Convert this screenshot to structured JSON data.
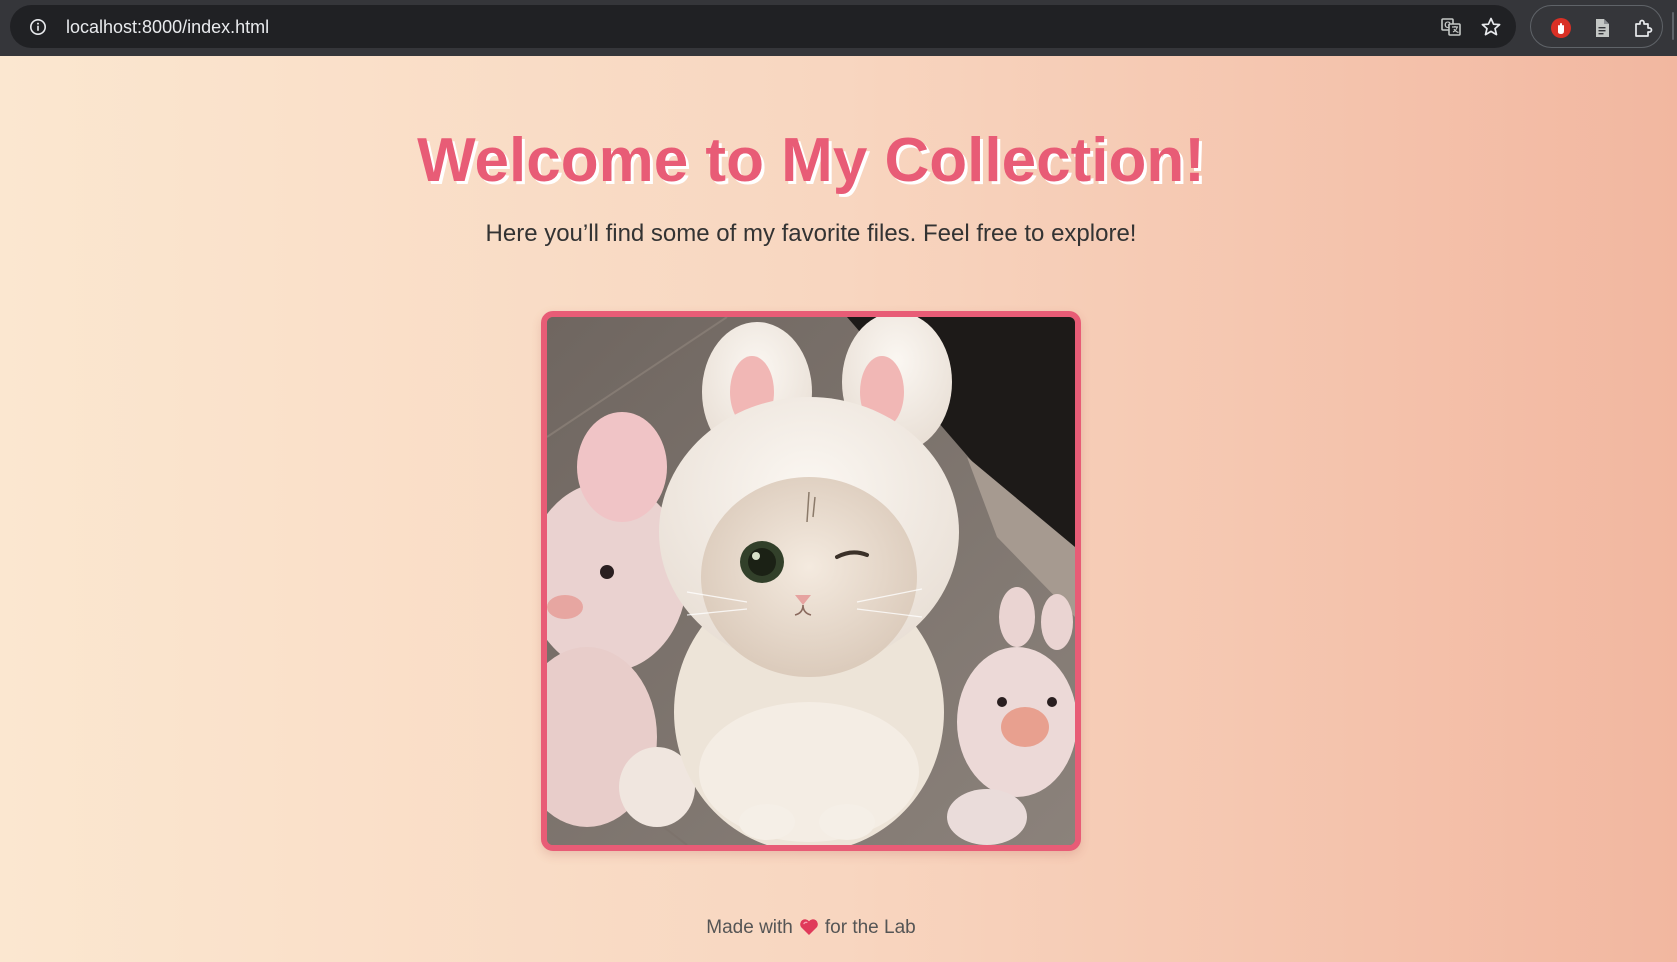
{
  "browser": {
    "url": "localhost:8000/index.html",
    "icons": [
      "info-icon",
      "translate-icon",
      "star-icon",
      "adblock-icon",
      "document-icon",
      "extensions-icon"
    ]
  },
  "page": {
    "title": "Welcome to My Collection!",
    "subtitle": "Here you’ll find some of my favorite files. Feel free to explore!",
    "image": {
      "subject": "cat wearing bunny-ear hat with stuffed toys"
    },
    "footer": {
      "prefix": "Made with",
      "suffix": "for the Lab",
      "icon": "heart-icon"
    }
  },
  "colors": {
    "accent": "#e85c76",
    "text": "#333333",
    "background_start": "#fbe7d0",
    "background_end": "#f2b7a0"
  }
}
